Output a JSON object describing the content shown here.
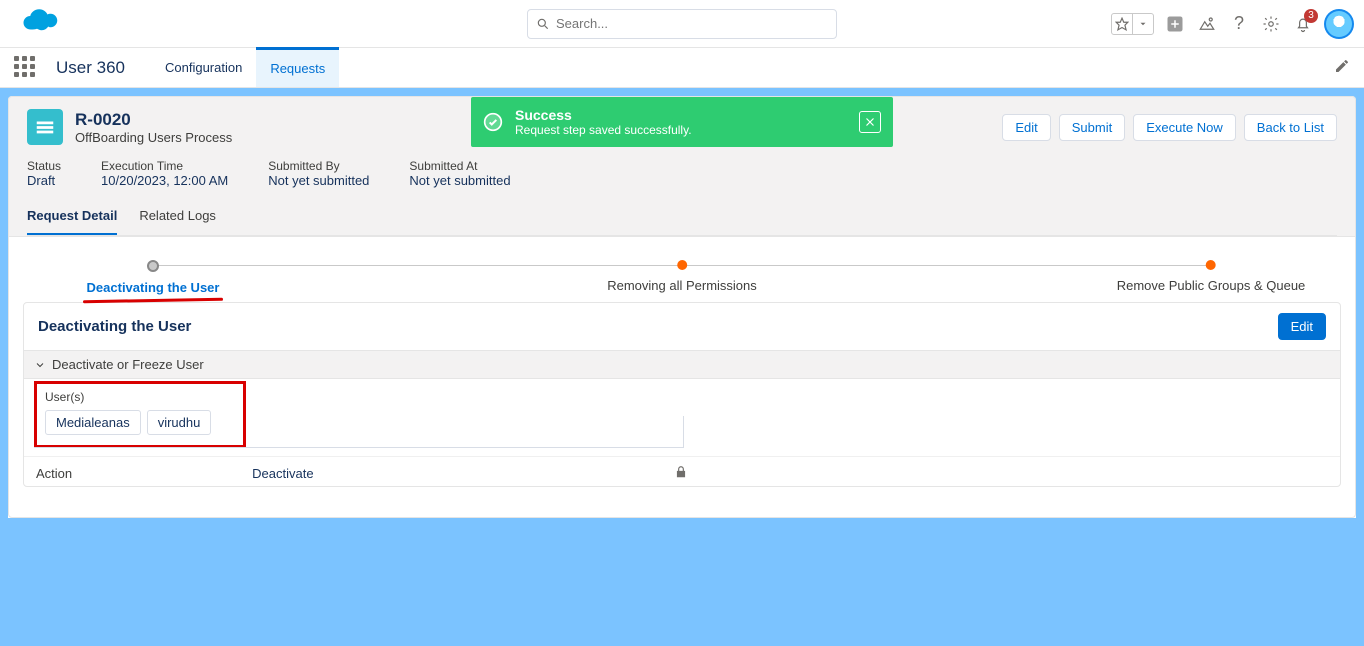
{
  "topbar": {
    "search_placeholder": "Search...",
    "notification_count": "3"
  },
  "nav": {
    "app_name": "User 360",
    "tabs": [
      {
        "label": "Configuration",
        "active": false
      },
      {
        "label": "Requests",
        "active": true
      }
    ]
  },
  "toast": {
    "title": "Success",
    "message": "Request step saved successfully."
  },
  "header": {
    "record_name": "R-0020",
    "record_type": "OffBoarding Users Process",
    "actions": {
      "edit": "Edit",
      "submit": "Submit",
      "execute": "Execute Now",
      "back": "Back to List"
    },
    "meta": {
      "status_label": "Status",
      "status_value": "Draft",
      "exec_label": "Execution Time",
      "exec_value": "10/20/2023, 12:00 AM",
      "subby_label": "Submitted By",
      "subby_value": "Not yet submitted",
      "subat_label": "Submitted At",
      "subat_value": "Not yet submitted"
    },
    "detail_tabs": {
      "detail": "Request Detail",
      "logs": "Related Logs"
    }
  },
  "steps": [
    {
      "label": "Deactivating the User",
      "current": true
    },
    {
      "label": "Removing all Permissions",
      "current": false
    },
    {
      "label": "Remove Public Groups & Queue",
      "current": false
    }
  ],
  "section": {
    "title": "Deactivating the User",
    "edit_btn": "Edit",
    "collapse_label": "Deactivate or Freeze User",
    "users_label": "User(s)",
    "users": [
      {
        "name": "Medialeanas"
      },
      {
        "name": "virudhu"
      }
    ],
    "action_label": "Action",
    "action_value": "Deactivate"
  }
}
